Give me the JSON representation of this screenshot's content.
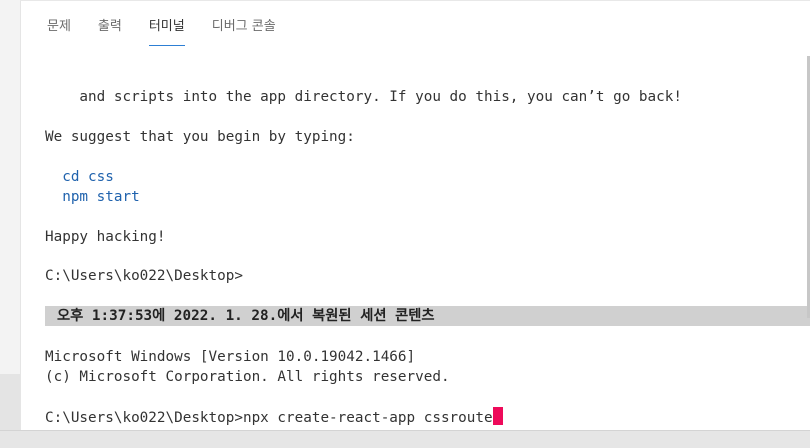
{
  "tabs": [
    {
      "label": "문제"
    },
    {
      "label": "출력"
    },
    {
      "label": "터미널",
      "active": true
    },
    {
      "label": "디버그 콘솔"
    }
  ],
  "terminal": {
    "lines": {
      "l1": "    and scripts into the app directory. If you do this, you can’t go back!",
      "l2": "We suggest that you begin by typing:",
      "l3": "  cd css",
      "l4": "  npm start",
      "l5": "Happy hacking!",
      "l6": "C:\\Users\\ko022\\Desktop>",
      "l7": "Microsoft Windows [Version 10.0.19042.1466]",
      "l8": "(c) Microsoft Corporation. All rights reserved.",
      "l9": "C:\\Users\\ko022\\Desktop>npx create-react-app cssroute"
    },
    "banner": "오후 1:37:53에 2022. 1. 28.에서 복원된 세션 콘텐츠"
  },
  "colors": {
    "active_tab_underline": "#2d7fd4",
    "command_text": "#1f62ad",
    "cursor": "#ee0a5a",
    "banner_bg": "#d0d0d0"
  }
}
